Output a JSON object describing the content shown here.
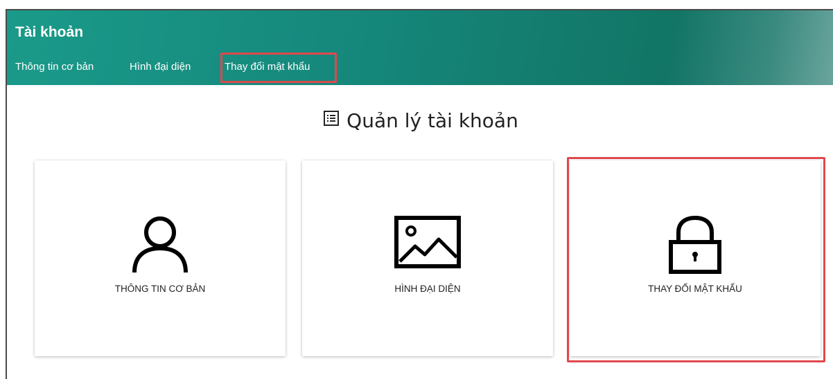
{
  "header": {
    "title": "Tài khoản",
    "tabs": [
      {
        "label": "Thông tin cơ bản"
      },
      {
        "label": "Hình đại diện"
      },
      {
        "label": "Thay đổi mật khẩu"
      }
    ],
    "background": "#15867a"
  },
  "main": {
    "section_title": "Quản lý tài khoản",
    "section_icon": "list-icon",
    "cards": [
      {
        "label": "THÔNG TIN CƠ BẢN",
        "icon": "user-icon"
      },
      {
        "label": "HÌNH ĐẠI DIỆN",
        "icon": "image-icon"
      },
      {
        "label": "THAY ĐỔI MẬT KHẨU",
        "icon": "lock-icon"
      }
    ]
  },
  "highlight_color": "#e0484d"
}
